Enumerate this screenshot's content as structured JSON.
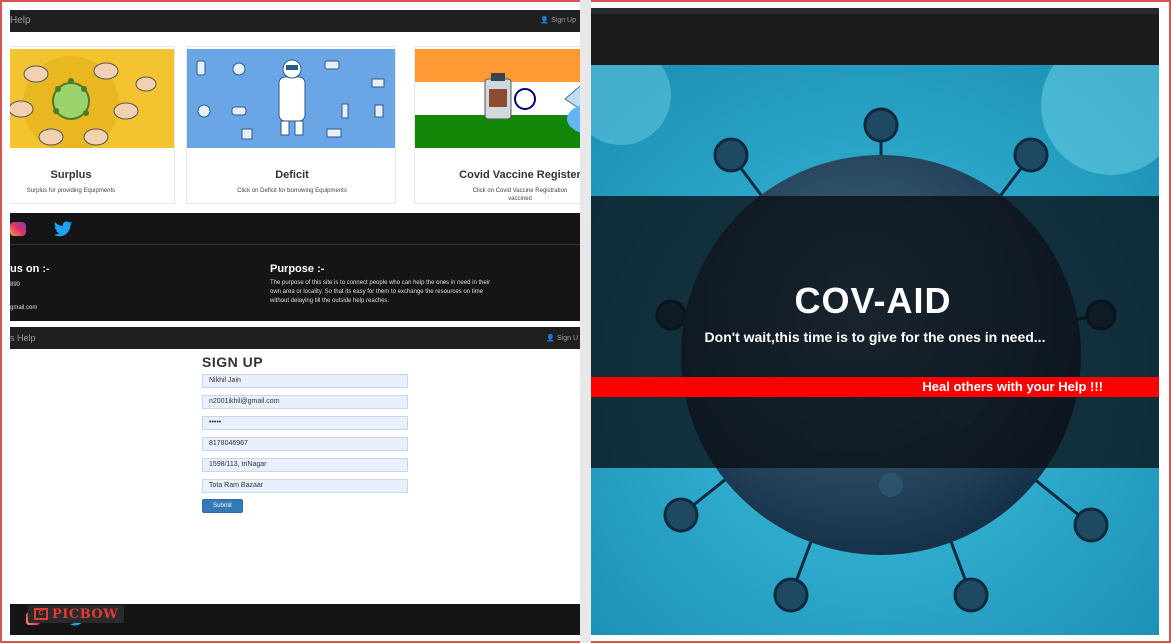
{
  "panel1": {
    "brand": "Help",
    "signup_link": "Sign Up",
    "cards": [
      {
        "title": "Surplus",
        "desc": "Surplus for providing Equipments"
      },
      {
        "title": "Deficit",
        "desc": "Click on Deficit for borrowing Equipments"
      },
      {
        "title": "Covid Vaccine Register",
        "desc": "Click on Covid Vaccine Registration",
        "desc2": "vaccined"
      }
    ],
    "footer": {
      "contact_heading": "us on :-",
      "contact_line1": "890",
      "contact_line2": "gmail.com",
      "purpose_heading": "Purpose :-",
      "purpose_text": "The purpose of this site is to connect people who can help the ones in need in their own area or locality. So that its easy for them to exchange the resources on time without delaying till the outside help reaches."
    }
  },
  "panel2": {
    "brand": "s Help",
    "signup_link": "Sign U",
    "form_title": "SIGN UP",
    "fields": [
      "Nikhil Jain",
      "n2001ikhil@gmail.com",
      "•••••",
      "8178046967",
      "1598/113, triNagar",
      "Tota Ram Bazaar"
    ],
    "submit_label": "Submit"
  },
  "watermark": {
    "box": "C",
    "text": "PICBOW"
  },
  "hero": {
    "title": "COV-AID",
    "subtitle": "Don't wait,this time is to give for the ones in need...",
    "banner": "Heal others with your Help !!!"
  },
  "colors": {
    "nav_dark": "#1f1f1f",
    "footer_dark": "#151515",
    "banner_red": "#ff0000",
    "submit_blue": "#337ab7",
    "hero_cyan": "#2bb7d8"
  }
}
